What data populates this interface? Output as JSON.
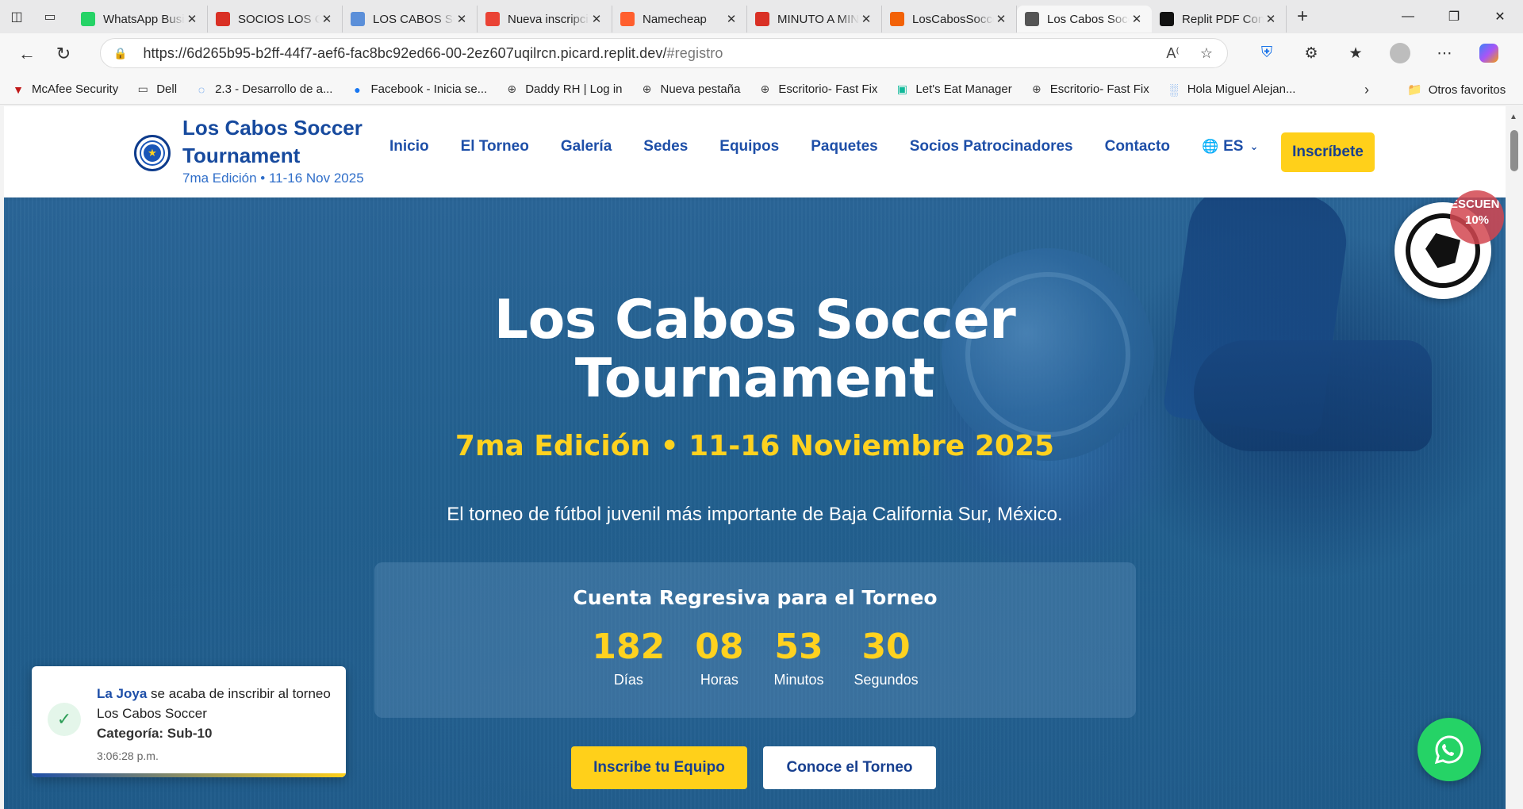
{
  "browser": {
    "tabs": [
      {
        "title": "WhatsApp Business",
        "favicon": "whatsapp-icon",
        "color": "#25d366"
      },
      {
        "title": "SOCIOS LOS CABOS",
        "favicon": "pdf-icon",
        "color": "#d93025"
      },
      {
        "title": "LOS CABOS SOCCER",
        "favicon": "doc-icon",
        "color": "#5b8fd9"
      },
      {
        "title": "Nueva inscripción",
        "favicon": "gmail-icon",
        "color": "#ea4335"
      },
      {
        "title": "Namecheap",
        "favicon": "namecheap-icon",
        "color": "#ff5f2e"
      },
      {
        "title": "MINUTO A MINUTO",
        "favicon": "pdf-icon",
        "color": "#d93025"
      },
      {
        "title": "LosCabosSoccer",
        "favicon": "replit-icon",
        "color": "#f26207"
      },
      {
        "title": "Los Cabos Soccer",
        "favicon": "globe-icon",
        "color": "#555555",
        "active": true
      },
      {
        "title": "Replit PDF Converter",
        "favicon": "openai-icon",
        "color": "#111111"
      }
    ],
    "url_main": "https://6d265b95-b2ff-44f7-aef6-fac8bc92ed66-00-2ez607uqilrcn.picard.replit.dev/",
    "url_hash": "#registro",
    "bookmarks": [
      {
        "label": "McAfee Security",
        "icon": "mcafee-icon",
        "color": "#c01818"
      },
      {
        "label": "Dell",
        "icon": "folder-icon",
        "color": "#444444"
      },
      {
        "label": "2.3 - Desarrollo de a...",
        "icon": "loading-icon",
        "color": "#1a73e8"
      },
      {
        "label": "Facebook - Inicia se...",
        "icon": "facebook-icon",
        "color": "#1877f2"
      },
      {
        "label": "Daddy RH | Log in",
        "icon": "globe-icon",
        "color": "#444444"
      },
      {
        "label": "Nueva pestaña",
        "icon": "globe-icon",
        "color": "#444444"
      },
      {
        "label": "Escritorio- Fast Fix",
        "icon": "globe-icon",
        "color": "#444444"
      },
      {
        "label": "Let's Eat Manager",
        "icon": "app-icon",
        "color": "#10b99a"
      },
      {
        "label": "Escritorio- Fast Fix",
        "icon": "globe-icon",
        "color": "#444444"
      },
      {
        "label": "Hola Miguel Alejan...",
        "icon": "chart-icon",
        "color": "#2b7de9"
      }
    ],
    "other_favorites": "Otros favoritos"
  },
  "site": {
    "brand_title": "Los Cabos Soccer Tournament",
    "brand_sub": "7ma Edición • 11-16 Nov 2025",
    "nav": [
      "Inicio",
      "El Torneo",
      "Galería",
      "Sedes",
      "Equipos",
      "Paquetes",
      "Socios Patrocinadores",
      "Contacto"
    ],
    "lang": "ES",
    "cta": "Inscríbete"
  },
  "hero": {
    "title_line1": "Los Cabos Soccer",
    "title_line2": "Tournament",
    "subtitle": "7ma Edición • 11-16 Noviembre 2025",
    "description": "El torneo de fútbol juvenil más importante de Baja California Sur, México.",
    "countdown_title": "Cuenta Regresiva para el Torneo",
    "countdown": [
      {
        "value": "182",
        "label": "Días"
      },
      {
        "value": "08",
        "label": "Horas"
      },
      {
        "value": "53",
        "label": "Minutos"
      },
      {
        "value": "30",
        "label": "Segundos"
      }
    ],
    "btn_primary": "Inscribe tu Equipo",
    "btn_secondary": "Conoce el Torneo"
  },
  "toast": {
    "team": "La Joya",
    "message": " se acaba de inscribir al torneo Los Cabos Soccer",
    "category": "Categoría: Sub-10",
    "time": "3:06:28 p.m."
  },
  "promo": {
    "badge_line1": "ESCUENT",
    "badge_line2": "10%"
  },
  "colors": {
    "primary_blue": "#1e4fa8",
    "accent_yellow": "#ffd01a",
    "whatsapp_green": "#25d366"
  }
}
